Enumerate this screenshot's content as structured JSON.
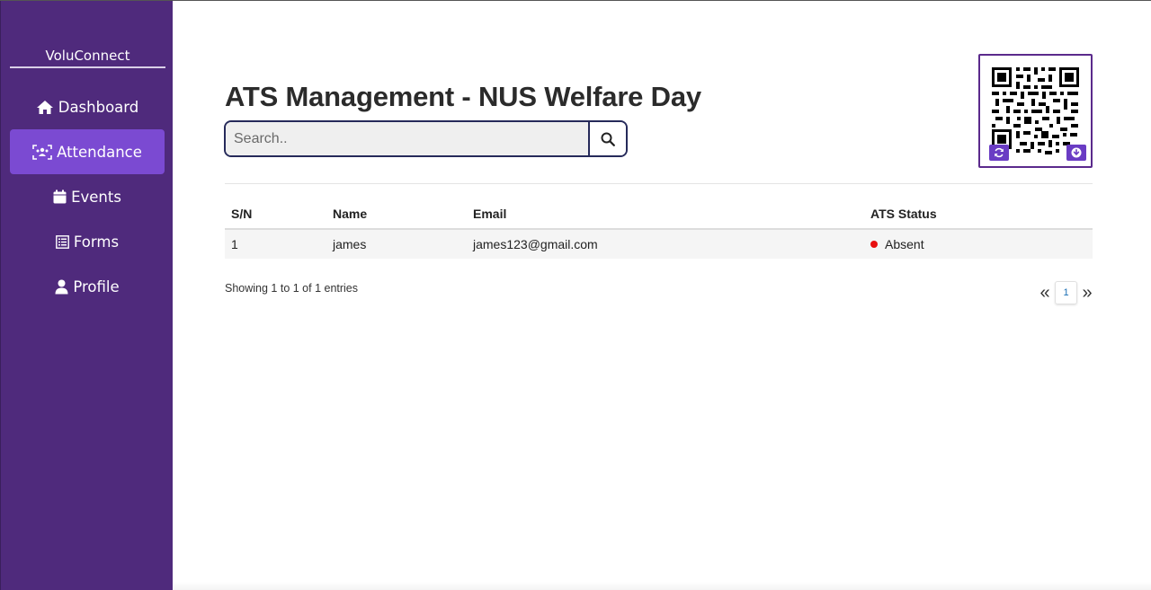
{
  "sidebar": {
    "brand": "VoluConnect",
    "items": [
      {
        "label": "Dashboard",
        "icon": "home-icon"
      },
      {
        "label": "Attendance",
        "icon": "attendance-icon",
        "active": true
      },
      {
        "label": "Events",
        "icon": "calendar-icon"
      },
      {
        "label": "Forms",
        "icon": "form-icon"
      },
      {
        "label": "Profile",
        "icon": "user-icon"
      }
    ],
    "color": "#4f2a7c",
    "active_color": "#7b4ad2"
  },
  "main": {
    "title": "ATS Management - NUS Welfare Day",
    "search": {
      "placeholder": "Search..",
      "value": ""
    },
    "qr": {
      "refresh_icon": "refresh-icon",
      "download_icon": "download-icon"
    },
    "table": {
      "headers": [
        "S/N",
        "Name",
        "Email",
        "ATS Status"
      ],
      "rows": [
        {
          "sn": "1",
          "name": "james",
          "email": "james123@gmail.com",
          "status": "Absent",
          "status_color": "#e81010"
        }
      ]
    },
    "entries_info": "Showing 1 to 1 of 1 entries",
    "pagination": {
      "prev": "«",
      "current": "1",
      "next": "»"
    }
  }
}
